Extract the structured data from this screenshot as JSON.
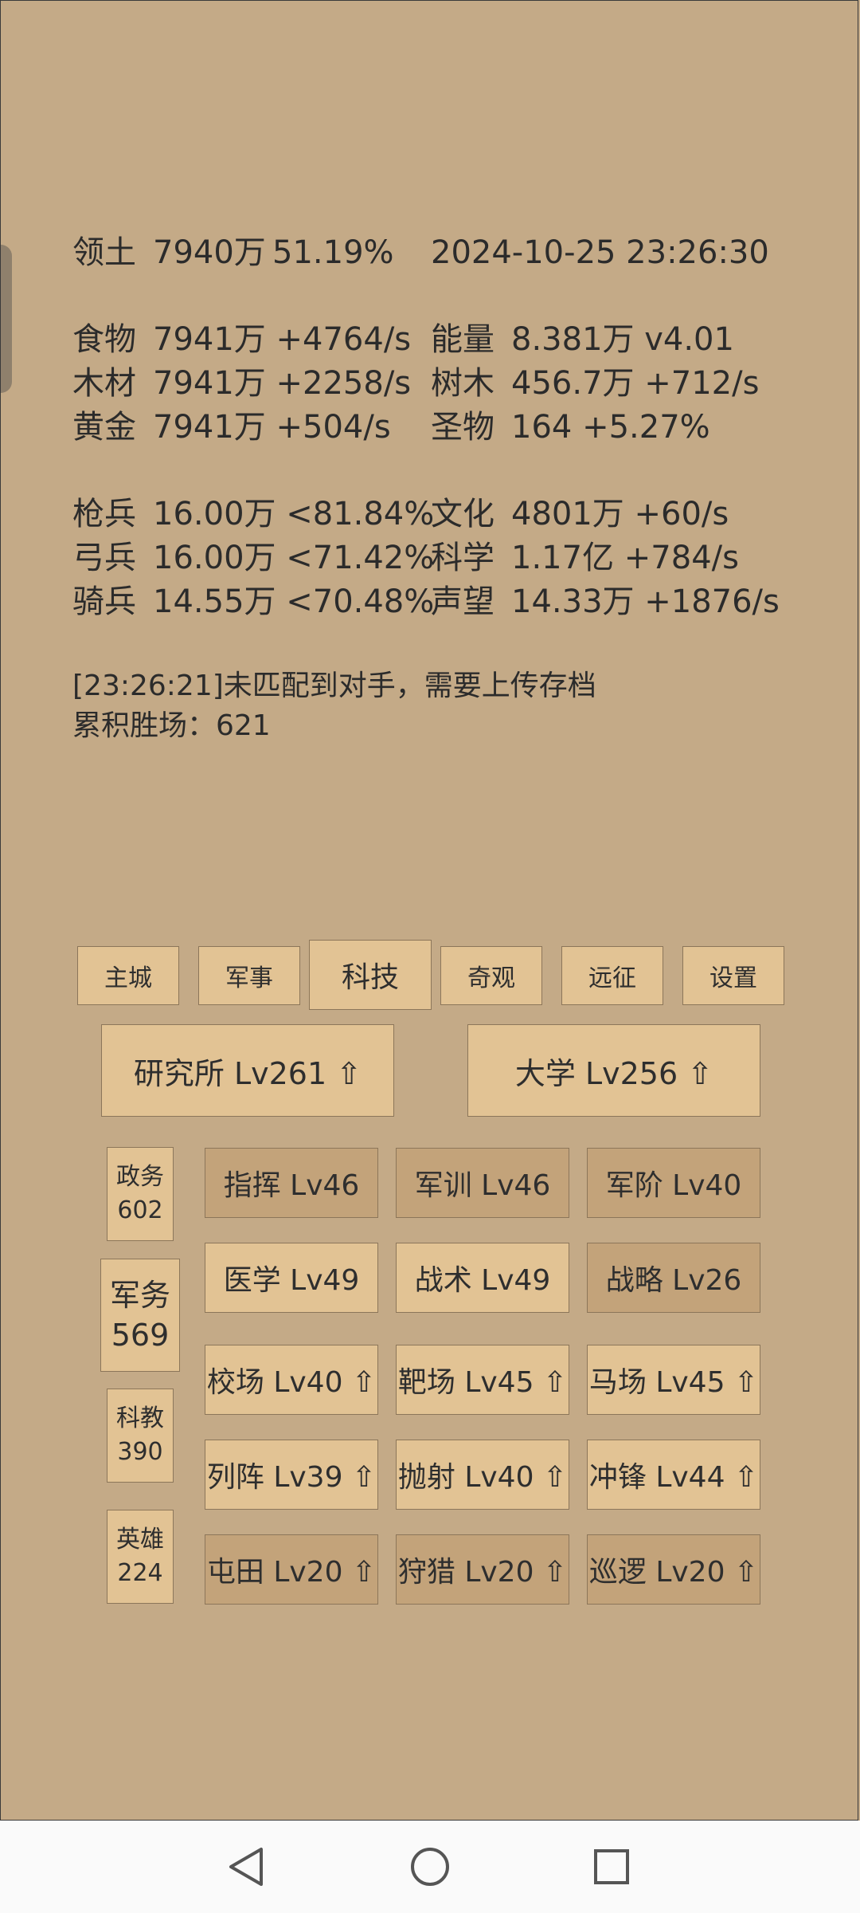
{
  "stats": {
    "territory": {
      "label": "领土",
      "value": "7940万",
      "pct": "51.19%"
    },
    "datetime": "2024-10-25 23:26:30",
    "rows": [
      [
        {
          "label": "食物",
          "value": "7941万 +4764/s"
        },
        {
          "label": "能量",
          "value": "8.381万  v4.01"
        }
      ],
      [
        {
          "label": "木材",
          "value": "7941万 +2258/s"
        },
        {
          "label": "树木",
          "value": "456.7万 +712/s"
        }
      ],
      [
        {
          "label": "黄金",
          "value": "7941万 +504/s"
        },
        {
          "label": "圣物",
          "value": "164 +5.27%"
        }
      ],
      [
        {
          "label": "枪兵",
          "value": "16.00万 <81.84%"
        },
        {
          "label": "文化",
          "value": "4801万 +60/s"
        }
      ],
      [
        {
          "label": "弓兵",
          "value": "16.00万 <71.42%"
        },
        {
          "label": "科学",
          "value": "1.17亿 +784/s"
        }
      ],
      [
        {
          "label": "骑兵",
          "value": "14.55万 <70.48%"
        },
        {
          "label": "声望",
          "value": "14.33万 +1876/s"
        }
      ]
    ]
  },
  "log": {
    "line1": "[23:26:21]未匹配到对手，需要上传存档",
    "line2": "累积胜场：621"
  },
  "tabs": [
    "主城",
    "军事",
    "科技",
    "奇观",
    "远征",
    "设置"
  ],
  "buildings": {
    "institute": "研究所 Lv261 ⇧",
    "university": "大学 Lv256 ⇧"
  },
  "categories": [
    {
      "name": "政务",
      "value": "602"
    },
    {
      "name": "军务",
      "value": "569"
    },
    {
      "name": "科教",
      "value": "390"
    },
    {
      "name": "英雄",
      "value": "224"
    }
  ],
  "techs": [
    "指挥 Lv46",
    "军训 Lv46",
    "军阶 Lv40",
    "医学 Lv49",
    "战术 Lv49",
    "战略 Lv26",
    "校场 Lv40 ⇧",
    "靶场 Lv45 ⇧",
    "马场 Lv45 ⇧",
    "列阵 Lv39 ⇧",
    "抛射 Lv40 ⇧",
    "冲锋 Lv44 ⇧",
    "屯田 Lv20 ⇧",
    "狩猎 Lv20 ⇧",
    "巡逻 Lv20 ⇧"
  ],
  "colors": {
    "background": "#c4aa87",
    "button": "#e2c394",
    "button_dark": "#c3a37a"
  },
  "nav": {
    "back": "back-icon",
    "home": "home-icon",
    "recents": "recents-icon"
  }
}
